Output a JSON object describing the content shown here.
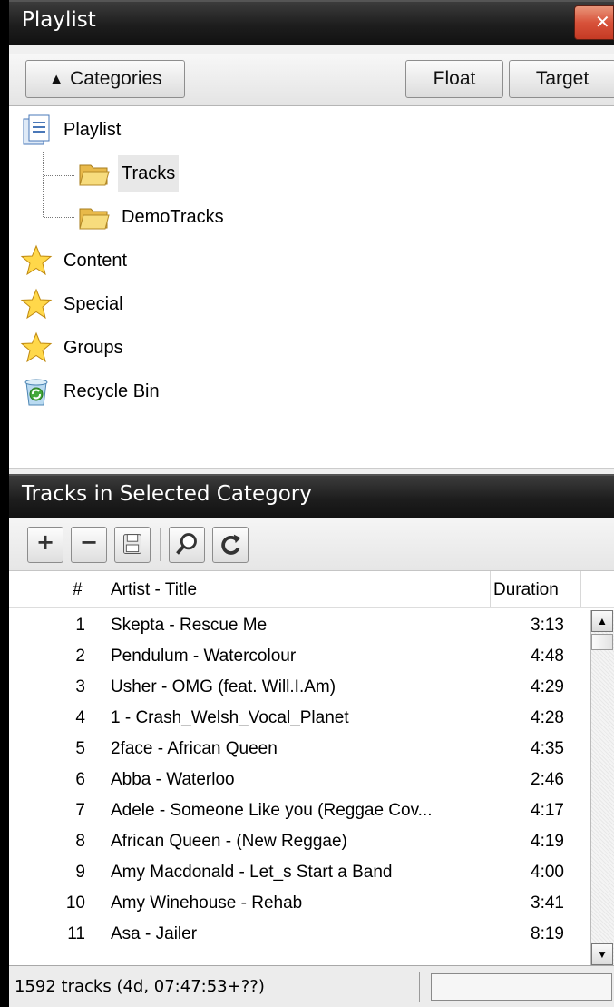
{
  "window": {
    "title": "Playlist"
  },
  "category_toolbar": {
    "categories_label": "Categories",
    "float_label": "Float",
    "target_label": "Target"
  },
  "tree": {
    "root": "Playlist",
    "children": [
      "Tracks",
      "DemoTracks"
    ],
    "selected": "Tracks",
    "others": [
      "Content",
      "Special",
      "Groups",
      "Recycle Bin"
    ]
  },
  "tracks_panel": {
    "title": "Tracks in Selected Category"
  },
  "list": {
    "headers": {
      "num": "#",
      "title": "Artist - Title",
      "duration": "Duration"
    },
    "rows": [
      {
        "n": "1",
        "title": "Skepta - Rescue Me",
        "dur": "3:13"
      },
      {
        "n": "2",
        "title": "Pendulum - Watercolour",
        "dur": "4:48"
      },
      {
        "n": "3",
        "title": "Usher - OMG (feat. Will.I.Am)",
        "dur": "4:29"
      },
      {
        "n": "4",
        "title": "1 - Crash_Welsh_Vocal_Planet",
        "dur": "4:28"
      },
      {
        "n": "5",
        "title": "2face - African Queen",
        "dur": "4:35"
      },
      {
        "n": "6",
        "title": "Abba - Waterloo",
        "dur": "2:46"
      },
      {
        "n": "7",
        "title": "Adele - Someone Like you (Reggae Cov...",
        "dur": "4:17"
      },
      {
        "n": "8",
        "title": "African Queen - (New Reggae)",
        "dur": "4:19"
      },
      {
        "n": "9",
        "title": "Amy Macdonald - Let_s Start a Band",
        "dur": "4:00"
      },
      {
        "n": "10",
        "title": "Amy Winehouse - Rehab",
        "dur": "3:41"
      },
      {
        "n": "11",
        "title": "Asa - Jailer",
        "dur": "8:19"
      }
    ]
  },
  "status": {
    "text": "1592 tracks (4d, 07:47:53+??)"
  }
}
